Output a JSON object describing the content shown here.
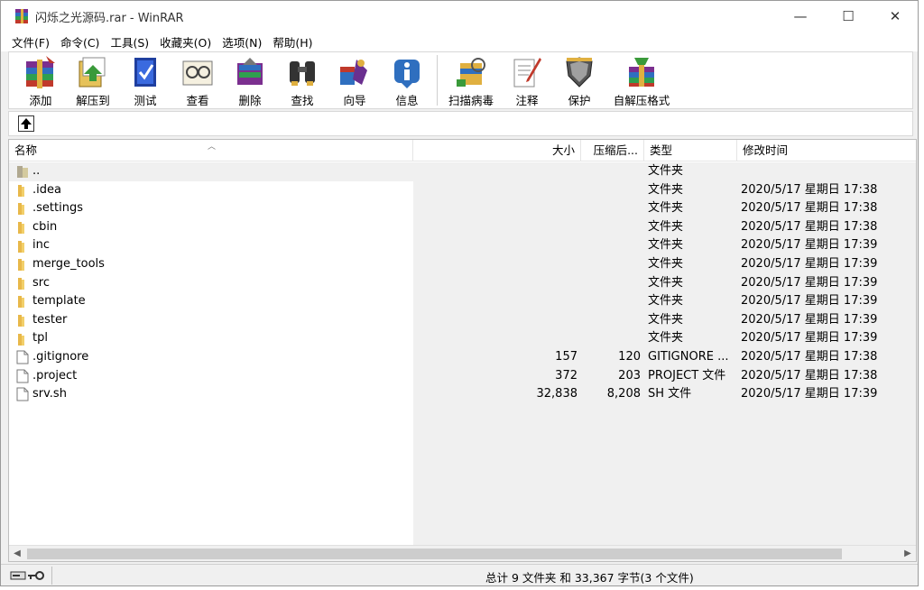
{
  "window": {
    "title": "闪烁之光源码.rar - WinRAR",
    "minimize": "—",
    "maximize": "☐",
    "close": "✕"
  },
  "menu": [
    "文件(F)",
    "命令(C)",
    "工具(S)",
    "收藏夹(O)",
    "选项(N)",
    "帮助(H)"
  ],
  "toolbar": [
    {
      "label": "添加",
      "icon": "add-archive-icon"
    },
    {
      "label": "解压到",
      "icon": "extract-to-icon"
    },
    {
      "label": "测试",
      "icon": "test-icon"
    },
    {
      "label": "查看",
      "icon": "view-icon"
    },
    {
      "label": "删除",
      "icon": "delete-icon"
    },
    {
      "label": "查找",
      "icon": "find-icon"
    },
    {
      "label": "向导",
      "icon": "wizard-icon"
    },
    {
      "label": "信息",
      "icon": "info-icon"
    },
    {
      "label": "扫描病毒",
      "icon": "virus-scan-icon"
    },
    {
      "label": "注释",
      "icon": "comment-icon"
    },
    {
      "label": "保护",
      "icon": "protect-icon"
    },
    {
      "label": "自解压格式",
      "icon": "sfx-icon"
    }
  ],
  "columns": {
    "name": "名称",
    "size": "大小",
    "packed": "压缩后...",
    "type": "类型",
    "modified": "修改时间"
  },
  "files": [
    {
      "name": "..",
      "size": "",
      "packed": "",
      "type": "文件夹",
      "modified": "",
      "kind": "parent"
    },
    {
      "name": ".idea",
      "size": "",
      "packed": "",
      "type": "文件夹",
      "modified": "2020/5/17 星期日 17:38",
      "kind": "folder"
    },
    {
      "name": ".settings",
      "size": "",
      "packed": "",
      "type": "文件夹",
      "modified": "2020/5/17 星期日 17:38",
      "kind": "folder"
    },
    {
      "name": "cbin",
      "size": "",
      "packed": "",
      "type": "文件夹",
      "modified": "2020/5/17 星期日 17:38",
      "kind": "folder"
    },
    {
      "name": "inc",
      "size": "",
      "packed": "",
      "type": "文件夹",
      "modified": "2020/5/17 星期日 17:39",
      "kind": "folder"
    },
    {
      "name": "merge_tools",
      "size": "",
      "packed": "",
      "type": "文件夹",
      "modified": "2020/5/17 星期日 17:39",
      "kind": "folder"
    },
    {
      "name": "src",
      "size": "",
      "packed": "",
      "type": "文件夹",
      "modified": "2020/5/17 星期日 17:39",
      "kind": "folder"
    },
    {
      "name": "template",
      "size": "",
      "packed": "",
      "type": "文件夹",
      "modified": "2020/5/17 星期日 17:39",
      "kind": "folder"
    },
    {
      "name": "tester",
      "size": "",
      "packed": "",
      "type": "文件夹",
      "modified": "2020/5/17 星期日 17:39",
      "kind": "folder"
    },
    {
      "name": "tpl",
      "size": "",
      "packed": "",
      "type": "文件夹",
      "modified": "2020/5/17 星期日 17:39",
      "kind": "folder"
    },
    {
      "name": ".gitignore",
      "size": "157",
      "packed": "120",
      "type": "GITIGNORE ...",
      "modified": "2020/5/17 星期日 17:38",
      "kind": "file"
    },
    {
      "name": ".project",
      "size": "372",
      "packed": "203",
      "type": "PROJECT 文件",
      "modified": "2020/5/17 星期日 17:38",
      "kind": "file"
    },
    {
      "name": "srv.sh",
      "size": "32,838",
      "packed": "8,208",
      "type": "SH 文件",
      "modified": "2020/5/17 星期日 17:39",
      "kind": "file"
    }
  ],
  "status": {
    "text": "总计 9 文件夹 和 33,367 字节(3 个文件)"
  },
  "colors": {
    "folder": "#e8b84a",
    "window_bg": "#f0f0f0",
    "scroll_thumb": "#cdcdcd"
  }
}
